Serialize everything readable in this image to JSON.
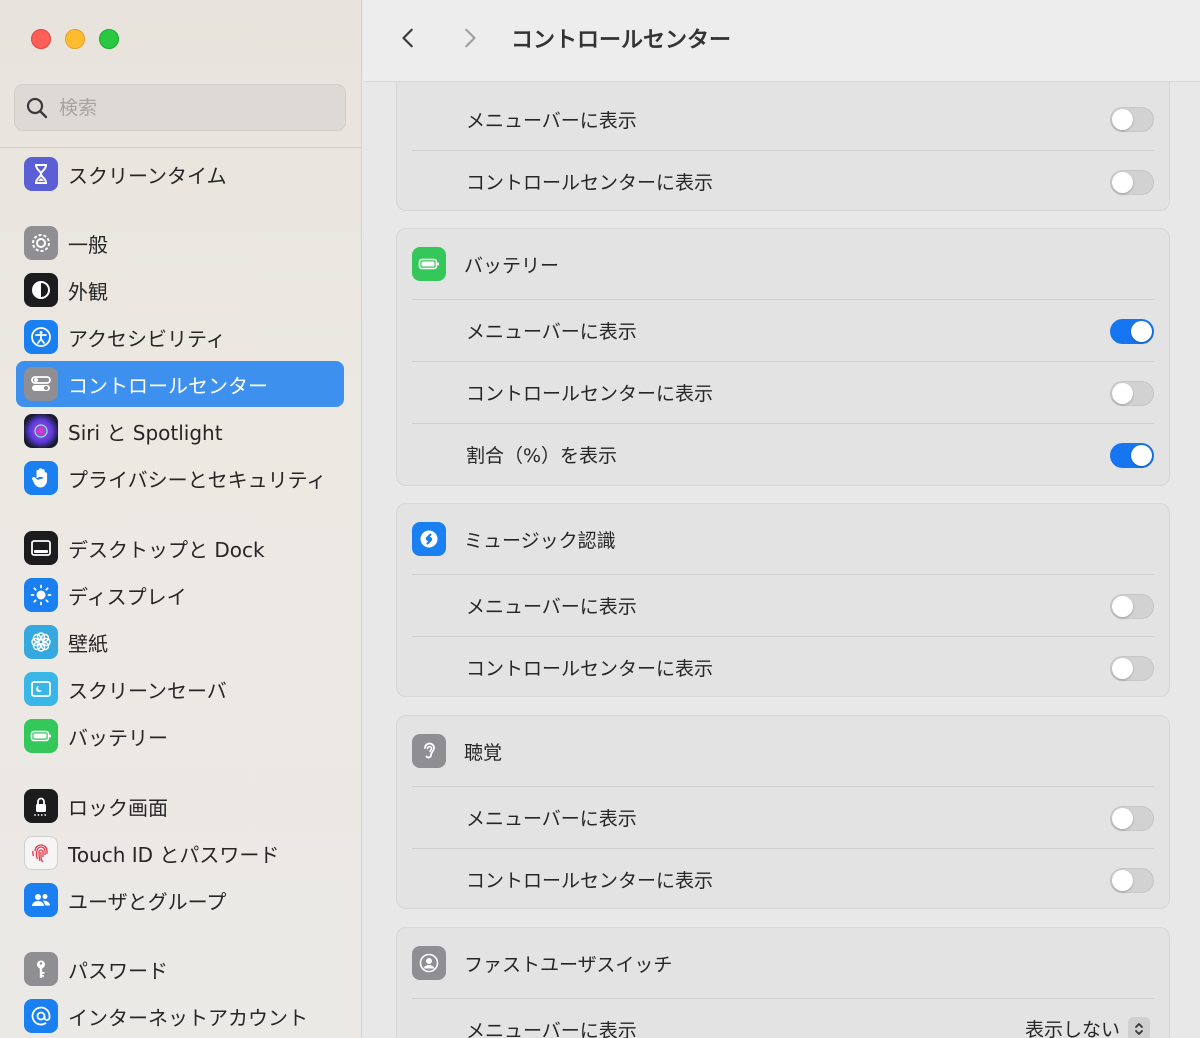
{
  "window": {
    "title": "コントロールセンター"
  },
  "search": {
    "placeholder": "検索"
  },
  "sidebar": {
    "items": [
      {
        "label": "スクリーンタイム",
        "icon": "hourglass-icon",
        "color": "#5a5fd6"
      },
      {
        "label": "一般",
        "icon": "gear-icon",
        "color": "#8e8e93"
      },
      {
        "label": "外観",
        "icon": "appearance-icon",
        "color": "#1c1c1e"
      },
      {
        "label": "アクセシビリティ",
        "icon": "accessibility-icon",
        "color": "#1a7ff0"
      },
      {
        "label": "コントロールセンター",
        "icon": "control-center-icon",
        "color": "#8e8e93",
        "selected": true
      },
      {
        "label": "Siri と Spotlight",
        "icon": "siri-icon",
        "color": "#2a2a3a"
      },
      {
        "label": "プライバシーとセキュリティ",
        "icon": "hand-icon",
        "color": "#1a7ff0"
      },
      {
        "label": "デスクトップと Dock",
        "icon": "dock-icon",
        "color": "#1c1c1e"
      },
      {
        "label": "ディスプレイ",
        "icon": "sun-icon",
        "color": "#1a7ff0"
      },
      {
        "label": "壁紙",
        "icon": "flower-icon",
        "color": "#35a8e0"
      },
      {
        "label": "スクリーンセーバ",
        "icon": "screensaver-icon",
        "color": "#38b6e8"
      },
      {
        "label": "バッテリー",
        "icon": "battery-icon",
        "color": "#34c759"
      },
      {
        "label": "ロック画面",
        "icon": "lock-icon",
        "color": "#1c1c1e"
      },
      {
        "label": "Touch ID とパスワード",
        "icon": "fingerprint-icon",
        "color": "#f5f5f5"
      },
      {
        "label": "ユーザとグループ",
        "icon": "users-icon",
        "color": "#1a7ff0"
      },
      {
        "label": "パスワード",
        "icon": "key-icon",
        "color": "#8e8e93"
      },
      {
        "label": "インターネットアカウント",
        "icon": "at-icon",
        "color": "#1a7ff0"
      }
    ]
  },
  "main": {
    "title": "コントロールセンター",
    "panels": [
      {
        "rows": [
          {
            "label": "メニューバーに表示",
            "on": false
          },
          {
            "label": "コントロールセンターに表示",
            "on": false
          }
        ]
      },
      {
        "title": "バッテリー",
        "icon": "battery-icon",
        "color": "#34c759",
        "rows": [
          {
            "label": "メニューバーに表示",
            "on": true
          },
          {
            "label": "コントロールセンターに表示",
            "on": false
          },
          {
            "label": "割合（%）を表示",
            "on": true
          }
        ]
      },
      {
        "title": "ミュージック認識",
        "icon": "shazam-icon",
        "color": "#1a7ff0",
        "rows": [
          {
            "label": "メニューバーに表示",
            "on": false
          },
          {
            "label": "コントロールセンターに表示",
            "on": false
          }
        ]
      },
      {
        "title": "聴覚",
        "icon": "ear-icon",
        "color": "#8e8e93",
        "rows": [
          {
            "label": "メニューバーに表示",
            "on": false
          },
          {
            "label": "コントロールセンターに表示",
            "on": false
          }
        ]
      },
      {
        "title": "ファストユーザスイッチ",
        "icon": "user-switch-icon",
        "color": "#8e8e93",
        "rows": [
          {
            "label": "メニューバーに表示",
            "value": "表示しない"
          }
        ]
      }
    ]
  },
  "colors": {
    "accent": "#3e90ef",
    "toggle_on": "#1676f1"
  }
}
